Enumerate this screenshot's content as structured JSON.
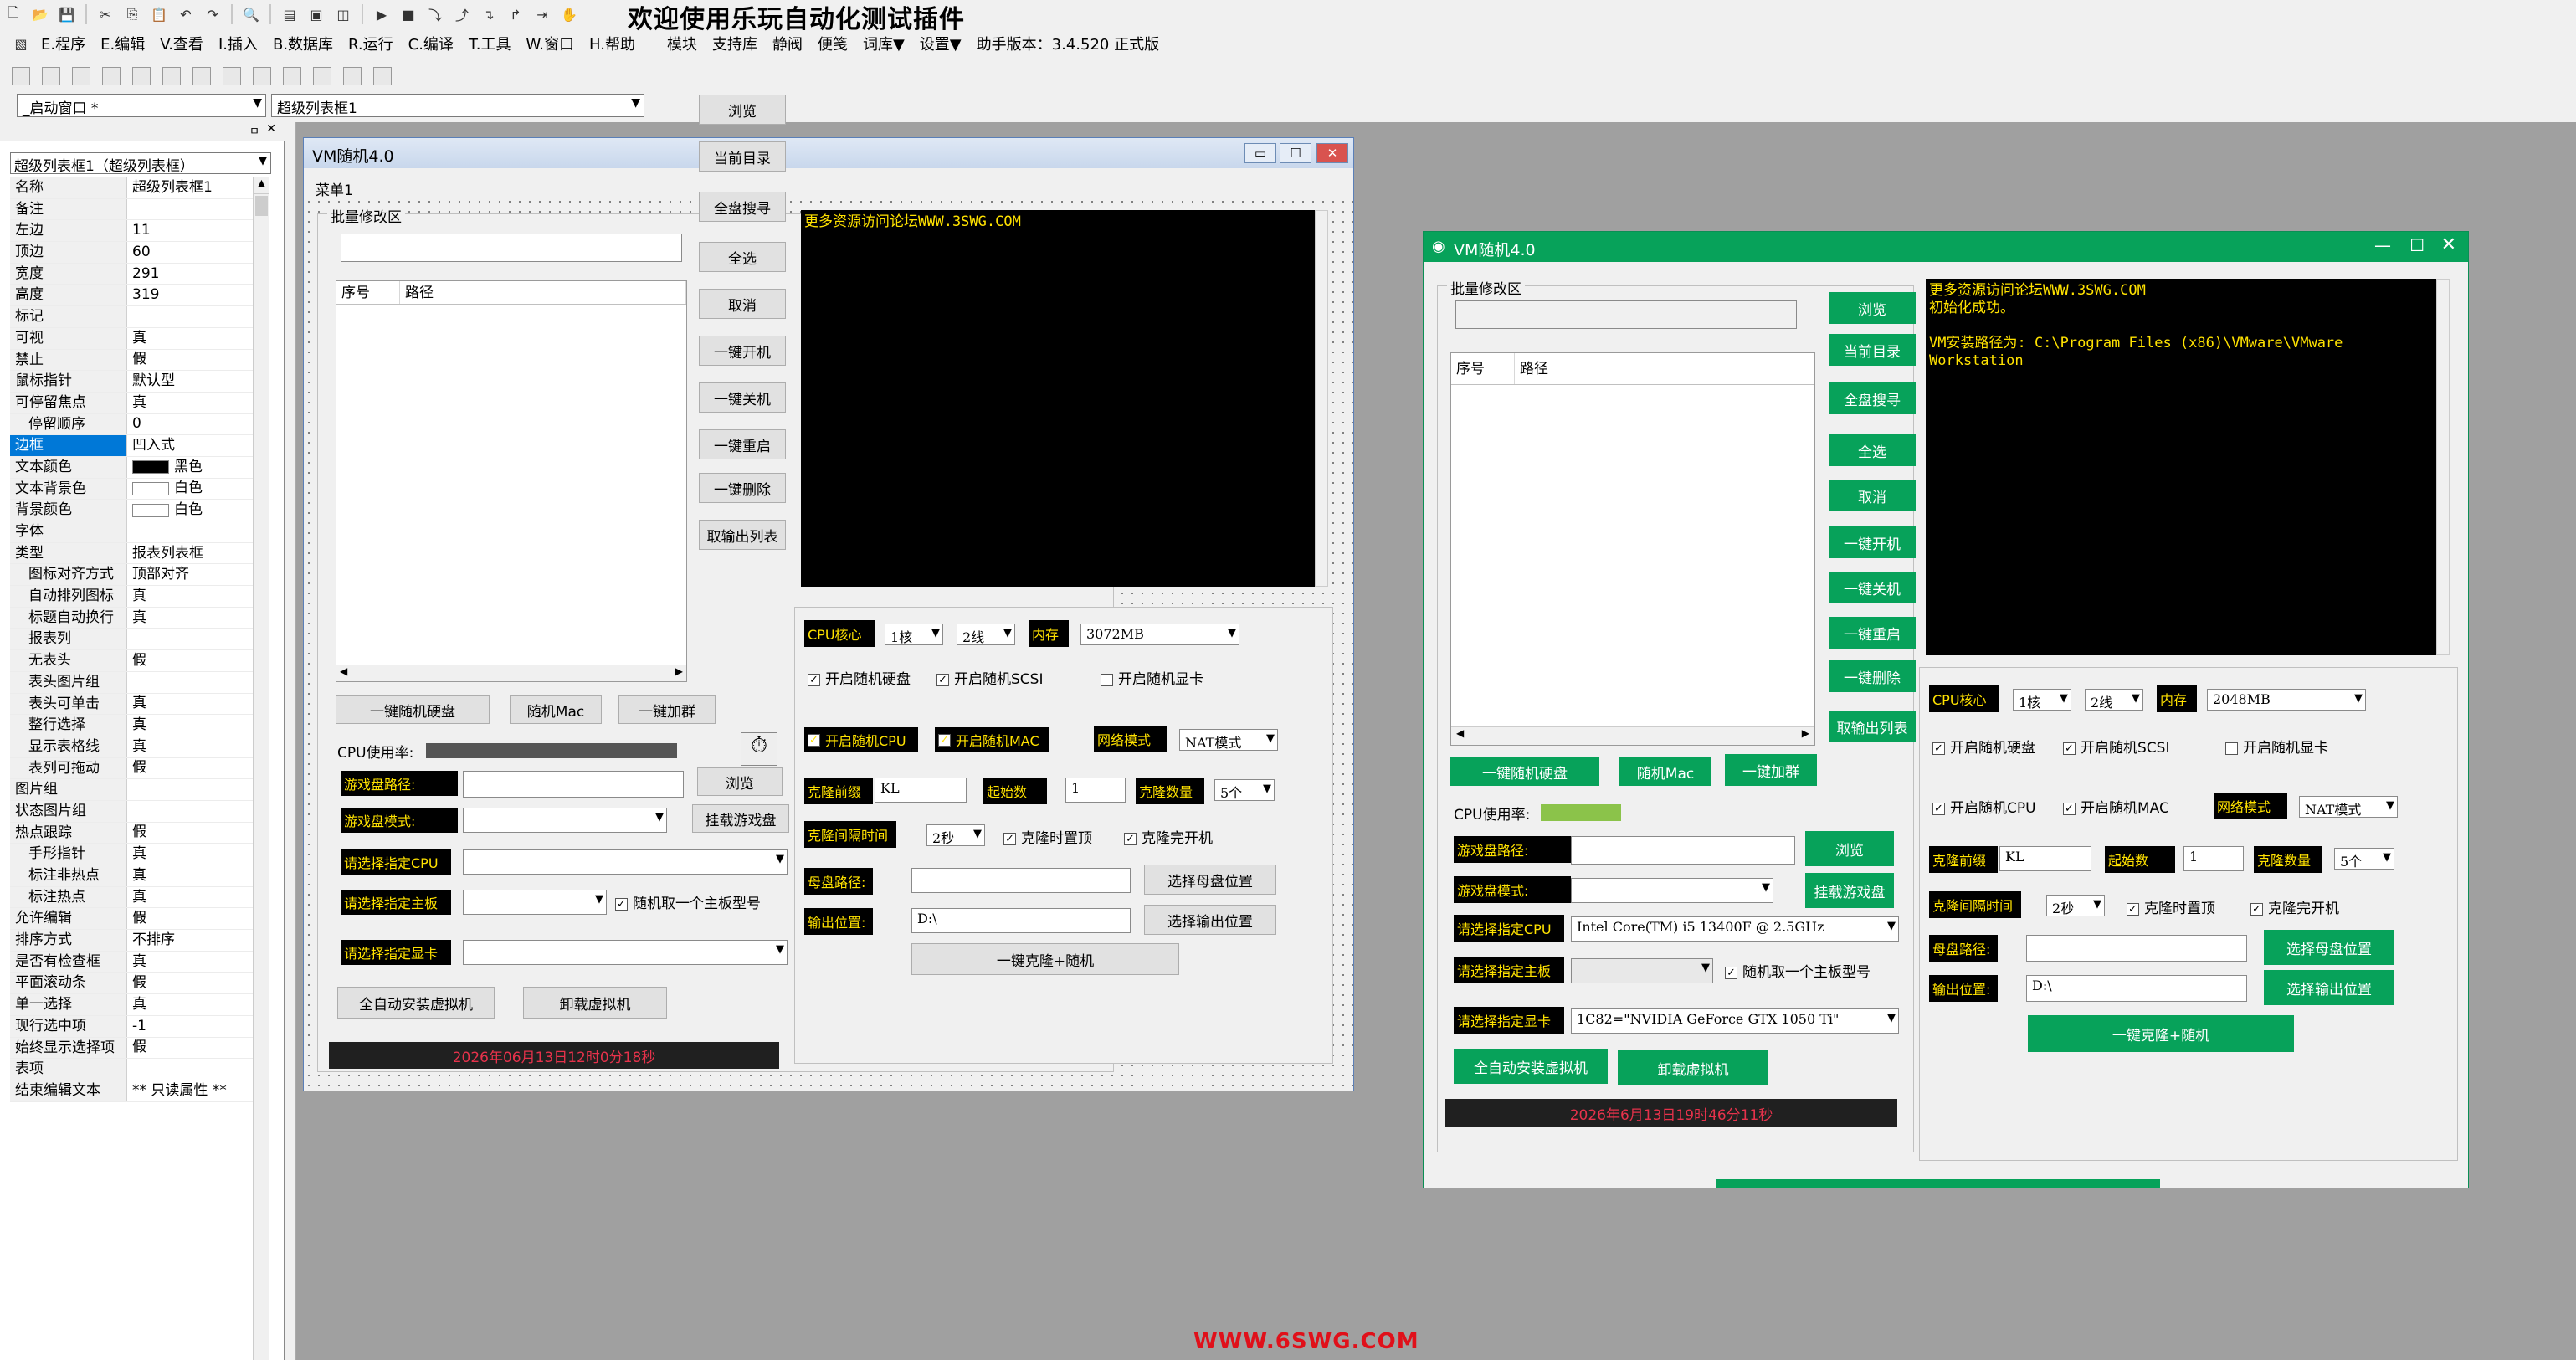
{
  "ide": {
    "title": "欢迎使用乐玩自动化测试插件",
    "menu": [
      "E.程序",
      "E.编辑",
      "V.查看",
      "I.插入",
      "B.数据库",
      "R.运行",
      "C.编译",
      "T.工具",
      "W.窗口",
      "H.帮助",
      "模块",
      "支持库",
      "静阀",
      "便笺",
      "词库▼",
      "设置▼",
      "助手版本：3.4.520 正式版"
    ],
    "window_combo": "_启动窗口 *",
    "control_combo": "超级列表框1",
    "close_glyph": "✕",
    "pin_glyph": "ㅁ"
  },
  "properties": {
    "object_combo": "超级列表框1（超级列表框）",
    "rows": [
      {
        "key": "名称",
        "value": "超级列表框1"
      },
      {
        "key": "备注",
        "value": ""
      },
      {
        "key": "左边",
        "value": "11"
      },
      {
        "key": "顶边",
        "value": "60"
      },
      {
        "key": "宽度",
        "value": "291"
      },
      {
        "key": "高度",
        "value": "319"
      },
      {
        "key": "标记",
        "value": ""
      },
      {
        "key": "可视",
        "value": "真"
      },
      {
        "key": "禁止",
        "value": "假"
      },
      {
        "key": "鼠标指针",
        "value": "默认型"
      },
      {
        "key": "可停留焦点",
        "value": "真"
      },
      {
        "key": "停留顺序",
        "value": "0",
        "indent": true
      },
      {
        "key": "边框",
        "value": "凹入式",
        "selected": true
      },
      {
        "key": "文本颜色",
        "value": "黑色",
        "swatch": "#000000"
      },
      {
        "key": "文本背景色",
        "value": "白色",
        "swatch": "#ffffff"
      },
      {
        "key": "背景颜色",
        "value": "白色",
        "swatch": "#ffffff"
      },
      {
        "key": "字体",
        "value": ""
      },
      {
        "key": "类型",
        "value": "报表列表框"
      },
      {
        "key": "图标对齐方式",
        "value": "顶部对齐",
        "indent": true
      },
      {
        "key": "自动排列图标",
        "value": "真",
        "indent": true
      },
      {
        "key": "标题自动换行",
        "value": "真",
        "indent": true
      },
      {
        "key": "报表列",
        "value": "",
        "indent": true
      },
      {
        "key": "无表头",
        "value": "假",
        "indent": true
      },
      {
        "key": "表头图片组",
        "value": "",
        "indent": true
      },
      {
        "key": "表头可单击",
        "value": "真",
        "indent": true
      },
      {
        "key": "整行选择",
        "value": "真",
        "indent": true
      },
      {
        "key": "显示表格线",
        "value": "真",
        "indent": true
      },
      {
        "key": "表列可拖动",
        "value": "假",
        "indent": true
      },
      {
        "key": "图片组",
        "value": ""
      },
      {
        "key": "状态图片组",
        "value": ""
      },
      {
        "key": "热点跟踪",
        "value": "假"
      },
      {
        "key": "手形指针",
        "value": "真",
        "indent": true
      },
      {
        "key": "标注非热点",
        "value": "真",
        "indent": true
      },
      {
        "key": "标注热点",
        "value": "真",
        "indent": true
      },
      {
        "key": "允许编辑",
        "value": "假"
      },
      {
        "key": "排序方式",
        "value": "不排序"
      },
      {
        "key": "是否有检查框",
        "value": "真"
      },
      {
        "key": "平面滚动条",
        "value": "假"
      },
      {
        "key": "单一选择",
        "value": "真"
      },
      {
        "key": "现行选中项",
        "value": "-1"
      },
      {
        "key": "始终显示选择项",
        "value": "假"
      },
      {
        "key": "表项",
        "value": ""
      },
      {
        "key": "结束编辑文本",
        "value": "** 只读属性 **"
      }
    ]
  },
  "win1": {
    "title": "VM随机4.0",
    "menu": "菜单1",
    "group": "批量修改区",
    "console": "更多资源访问论坛WWW.3SWG.COM",
    "list_cols": [
      "序号",
      "路径"
    ],
    "side_buttons": [
      "浏览",
      "当前目录",
      "全盘搜寻",
      "全选",
      "取消",
      "一键开机",
      "一键关机",
      "一键重启",
      "一键删除",
      "取输出列表"
    ],
    "bottom_buttons": [
      "一键随机硬盘",
      "随机Mac",
      "一键加群"
    ],
    "cpu_label": "CPU使用率:",
    "game_path": "游戏盘路径:",
    "game_mode": "游戏盘模式:",
    "sel_cpu": "请选择指定CPU",
    "sel_board": "请选择指定主板",
    "sel_gpu": "请选择指定显卡",
    "browse": "浏览",
    "mount": "挂载游戏盘",
    "random_board": "随机取一个主板型号",
    "auto_install": "全自动安装虚拟机",
    "uninstall": "卸载虚拟机",
    "status": "2026年06月13日12时0分18秒",
    "cpu_core_lbl": "CPU核心",
    "cpu_core": "1核",
    "threads": "2线",
    "mem_lbl": "内存",
    "mem": "3072MB",
    "chk_disk": "开启随机硬盘",
    "chk_scsi": "开启随机SCSI",
    "chk_gpu": "开启随机显卡",
    "chk_cpu": "开启随机CPU",
    "chk_mac": "开启随机MAC",
    "net_lbl": "网络模式",
    "net": "NAT模式",
    "prefix_lbl": "克隆前缀",
    "prefix": "KL",
    "start_lbl": "起始数",
    "start": "1",
    "count_lbl": "克隆数量",
    "count": "5个",
    "interval_lbl": "克隆间隔时间",
    "interval": "2秒",
    "chk_reset": "克隆时置顶",
    "chk_boot": "克隆完开机",
    "mother_lbl": "母盘路径:",
    "out_lbl": "输出位置:",
    "out": "D:\\",
    "pick_mother": "选择母盘位置",
    "pick_out": "选择输出位置",
    "clone": "一键克隆+随机"
  },
  "win2": {
    "title": "VM随机4.0",
    "group": "批量修改区",
    "console": "更多资源访问论坛WWW.3SWG.COM\n初始化成功。\n\nVM安装路径为: C:\\Program Files (x86)\\VMware\\VMware\nWorkstation",
    "list_cols": [
      "序号",
      "路径"
    ],
    "side_buttons": [
      "浏览",
      "当前目录",
      "全盘搜寻",
      "全选",
      "取消",
      "一键开机",
      "一键关机",
      "一键重启",
      "一键删除",
      "取输出列表"
    ],
    "bottom_buttons": [
      "一键随机硬盘",
      "随机Mac",
      "一键加群"
    ],
    "cpu_label": "CPU使用率:",
    "cpu_usage": 0.38,
    "game_path": "游戏盘路径:",
    "game_mode": "游戏盘模式:",
    "sel_cpu": "请选择指定CPU",
    "cpu_value": "Intel Core(TM) i5 13400F @ 2.5GHz",
    "sel_board": "请选择指定主板",
    "sel_gpu": "请选择指定显卡",
    "gpu_value": "1C82=\"NVIDIA GeForce GTX 1050 Ti\"",
    "browse": "浏览",
    "mount": "挂载游戏盘",
    "random_board": "随机取一个主板型号",
    "auto_install": "全自动安装虚拟机",
    "uninstall": "卸载虚拟机",
    "status": "2026年6月13日19时46分11秒",
    "cpu_core_lbl": "CPU核心",
    "cpu_core": "1核",
    "threads": "2线",
    "mem_lbl": "内存",
    "mem": "2048MB",
    "chk_disk": "开启随机硬盘",
    "chk_scsi": "开启随机SCSI",
    "chk_gpu": "开启随机显卡",
    "chk_cpu": "开启随机CPU",
    "chk_mac": "开启随机MAC",
    "net_lbl": "网络模式",
    "net": "NAT模式",
    "prefix_lbl": "克隆前缀",
    "prefix": "KL",
    "start_lbl": "起始数",
    "start": "1",
    "count_lbl": "克隆数量",
    "count": "5个",
    "interval_lbl": "克隆间隔时间",
    "interval": "2秒",
    "chk_reset": "克隆时置顶",
    "chk_boot": "克隆完开机",
    "mother_lbl": "母盘路径:",
    "out_lbl": "输出位置:",
    "out": "D:\\",
    "pick_mother": "选择母盘位置",
    "pick_out": "选择输出位置",
    "clone": "一键克隆+随机"
  },
  "watermark": "WWW.6SWG.COM",
  "colors": {
    "accent_green": "#07a25a",
    "console_text": "#ffe200",
    "status_text": "#e6324b",
    "cpu_green": "#8bc34a"
  }
}
